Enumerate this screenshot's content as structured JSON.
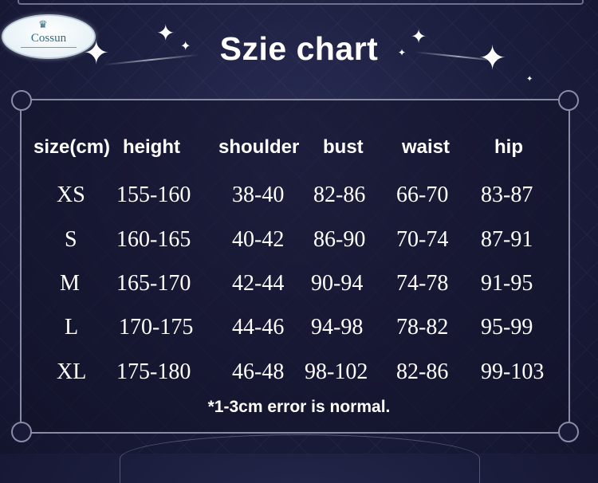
{
  "brand": {
    "logo_text": "Cossun"
  },
  "title": "Szie chart",
  "headers": [
    "size(cm)",
    "height",
    "shoulder",
    "bust",
    "waist",
    "hip"
  ],
  "rows": [
    [
      "XS",
      "155-160",
      "38-40",
      "82-86",
      "66-70",
      "83-87"
    ],
    [
      "S",
      "160-165",
      "40-42",
      "86-90",
      "70-74",
      "87-91"
    ],
    [
      "M",
      "165-170",
      "42-44",
      "90-94",
      "74-78",
      "91-95"
    ],
    [
      "L",
      "170-175",
      "44-46",
      "94-98",
      "78-82",
      "95-99"
    ],
    [
      "XL",
      "175-180",
      "46-48",
      "98-102",
      "82-86",
      "99-103"
    ]
  ],
  "note": "*1-3cm error is normal.",
  "colors": {
    "background": "#1b1d3d",
    "text": "#ffffff",
    "frame": "#8a8ca6",
    "logo": "#2f6b86"
  },
  "icons": [
    "sparkle-icon",
    "crown-icon"
  ]
}
